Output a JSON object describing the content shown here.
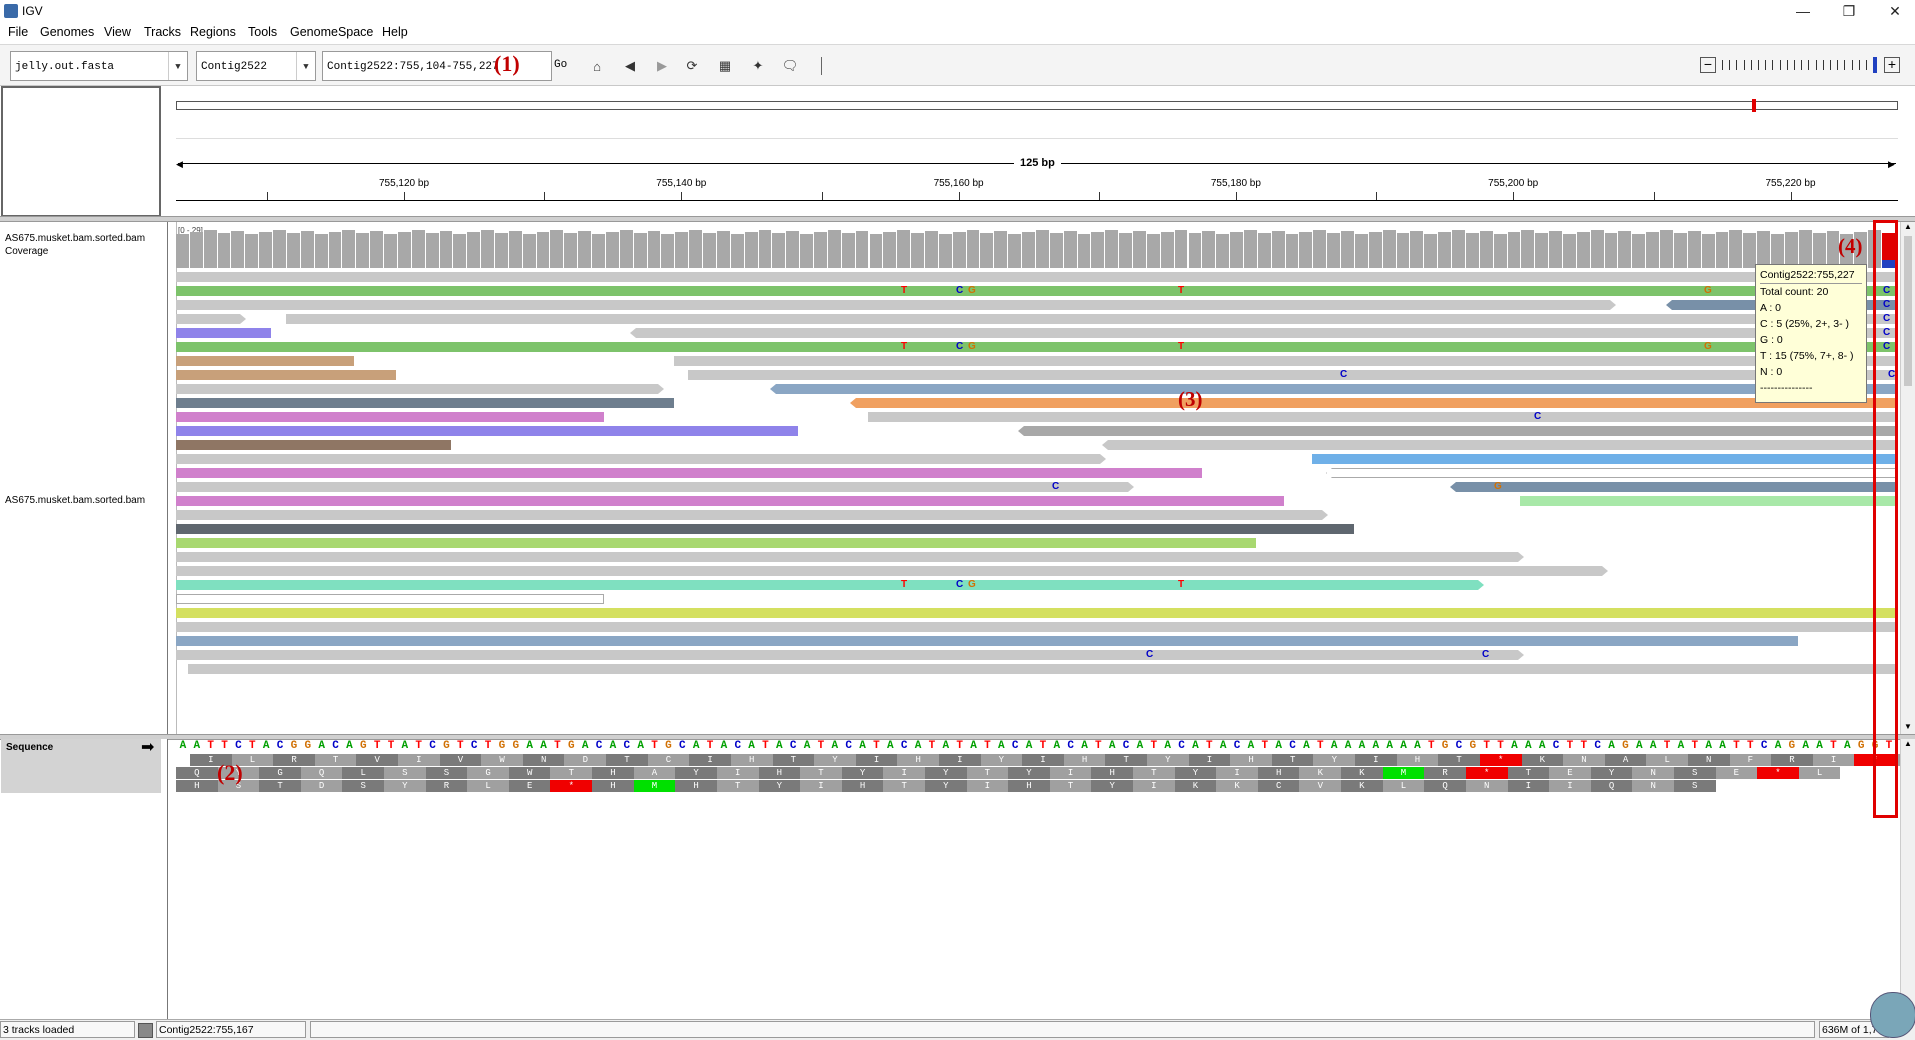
{
  "app": {
    "title": "IGV"
  },
  "menu": [
    "File",
    "Genomes",
    "View",
    "Tracks",
    "Regions",
    "Tools",
    "GenomeSpace",
    "Help"
  ],
  "toolbar": {
    "genome": "jelly.out.fasta",
    "chromosome": "Contig2522",
    "locus": "Contig2522:755,104-755,227",
    "go_label": "Go",
    "annotation1": "(1)"
  },
  "ruler": {
    "span_label": "125 bp",
    "ticks": [
      "755,120 bp",
      "755,140 bp",
      "755,160 bp",
      "755,180 bp",
      "755,200 bp",
      "755,220 bp"
    ]
  },
  "tracks": {
    "coverage_label": "AS675.musket.bam.sorted.bam Coverage",
    "coverage_range": "[0 - 29]",
    "alignment_label": "AS675.musket.bam.sorted.bam",
    "sequence_label": "Sequence"
  },
  "annotations": {
    "a2": "(2)",
    "a3": "(3)",
    "a4": "(4)"
  },
  "popup": {
    "lines": [
      "Contig2522:755,227",
      "Total count: 20",
      "A : 0",
      "C : 5 (25%, 2+, 3- )",
      "G : 0",
      "T : 15 (75%, 7+, 8- )",
      "N : 0",
      "---------------"
    ]
  },
  "sequence": {
    "bases": "AATTCTACGGACAGTTATCGTCTGGAATGACACATGCATACATACATACATACATATATACATACATACATACATACATACATAAAAAAATGCGTTAAACTTCAGAATATAATTCAGAATAGGT",
    "frame1": "ILRTVIVWNDTCIHTYIHIYIHTYIHTYIHT*KNALNFRI*I",
    "frame2": "QYGQLSSGWTHAYIHTYIYTYIHTYIHKKMR*TEYNSE*L",
    "frame3": "HSTDSYRLE*HMHTYIHTYIHTYIKKCVKLQNIIQNS"
  },
  "status": {
    "tracks_loaded": "3 tracks loaded",
    "position": "Contig2522:755,167",
    "memory": "636M of 1,7"
  },
  "colors": {
    "A": "#00a000",
    "C": "#0000c8",
    "G": "#d17105",
    "T": "#ff0000",
    "annotation": "#c00000"
  }
}
